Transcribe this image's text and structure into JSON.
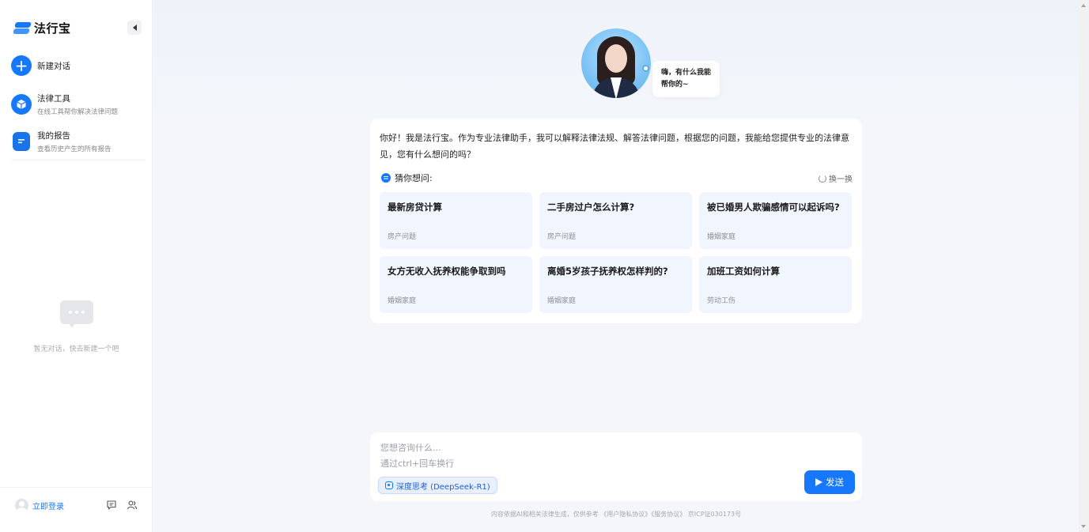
{
  "app": {
    "name": "法行宝"
  },
  "sidebar": {
    "new_chat_label": "新建对话",
    "items": [
      {
        "title": "法律工具",
        "subtitle": "在线工具帮你解决法律问题"
      },
      {
        "title": "我的报告",
        "subtitle": "查看历史产生的所有报告"
      }
    ],
    "empty_text": "暂无对话，快去新建一个吧",
    "login_label": "立即登录"
  },
  "hero": {
    "greeting": "嗨，有什么我能帮你的~"
  },
  "intro": {
    "text": "你好！我是法行宝。作为专业法律助手，我可以解释法律法规、解答法律问题，根据您的问题，我能给您提供专业的法律意见，您有什么想问的吗？"
  },
  "suggestions": {
    "label": "猜你想问:",
    "refresh_label": "换一换",
    "items": [
      {
        "title": "最新房贷计算",
        "tag": "房产问题"
      },
      {
        "title": "二手房过户怎么计算?",
        "tag": "房产问题"
      },
      {
        "title": "被已婚男人欺骗感情可以起诉吗?",
        "tag": "婚姻家庭"
      },
      {
        "title": "女方无收入抚养权能争取到吗",
        "tag": "婚姻家庭"
      },
      {
        "title": "离婚5岁孩子抚养权怎样判的?",
        "tag": "婚姻家庭"
      },
      {
        "title": "加班工资如何计算",
        "tag": "劳动工伤"
      }
    ]
  },
  "composer": {
    "placeholder": "您想咨询什么...",
    "hint": "通过ctrl+回车换行",
    "model_label": "深度思考 (DeepSeek-R1)",
    "send_label": "发送"
  },
  "footer": {
    "text": "内容依据AI和相关法律生成，仅供参考 《用户隐私协议》《服务协议》 京ICP证030173号"
  },
  "colors": {
    "accent": "#1677ff",
    "card_bg": "#f1f5fe"
  },
  "icons": [
    "logo-icon",
    "collapse-icon",
    "plus-icon",
    "cube-icon",
    "report-icon",
    "chat-bubble-icon",
    "user-icon",
    "feedback-icon",
    "contacts-icon",
    "list-icon",
    "refresh-icon",
    "deepthink-icon",
    "send-icon"
  ]
}
